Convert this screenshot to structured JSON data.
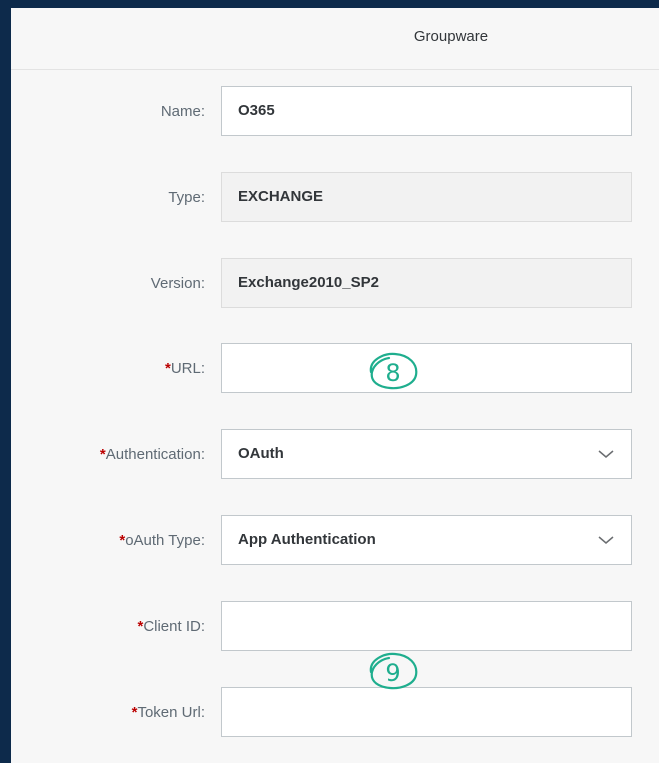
{
  "header": {
    "title": "Groupware"
  },
  "form": {
    "name": {
      "label": "Name:",
      "value": "O365"
    },
    "type": {
      "label": "Type:",
      "value": "EXCHANGE"
    },
    "version": {
      "label": "Version:",
      "value": "Exchange2010_SP2"
    },
    "url": {
      "required": "*",
      "label": "URL:",
      "value": ""
    },
    "authentication": {
      "required": "*",
      "label": "Authentication:",
      "value": "OAuth"
    },
    "oauth_type": {
      "required": "*",
      "label": "oAuth Type:",
      "value": "App Authentication"
    },
    "client_id": {
      "required": "*",
      "label": "Client ID:",
      "value": ""
    },
    "token_url": {
      "required": "*",
      "label": "Token Url:",
      "value": ""
    }
  },
  "annotations": {
    "callout_1": "8",
    "callout_2": "9"
  },
  "colors": {
    "background": "#0d2a4b",
    "required": "#bb0000",
    "callout": "#1fae8e"
  },
  "icons": {
    "dropdown": "chevron-down-icon"
  }
}
